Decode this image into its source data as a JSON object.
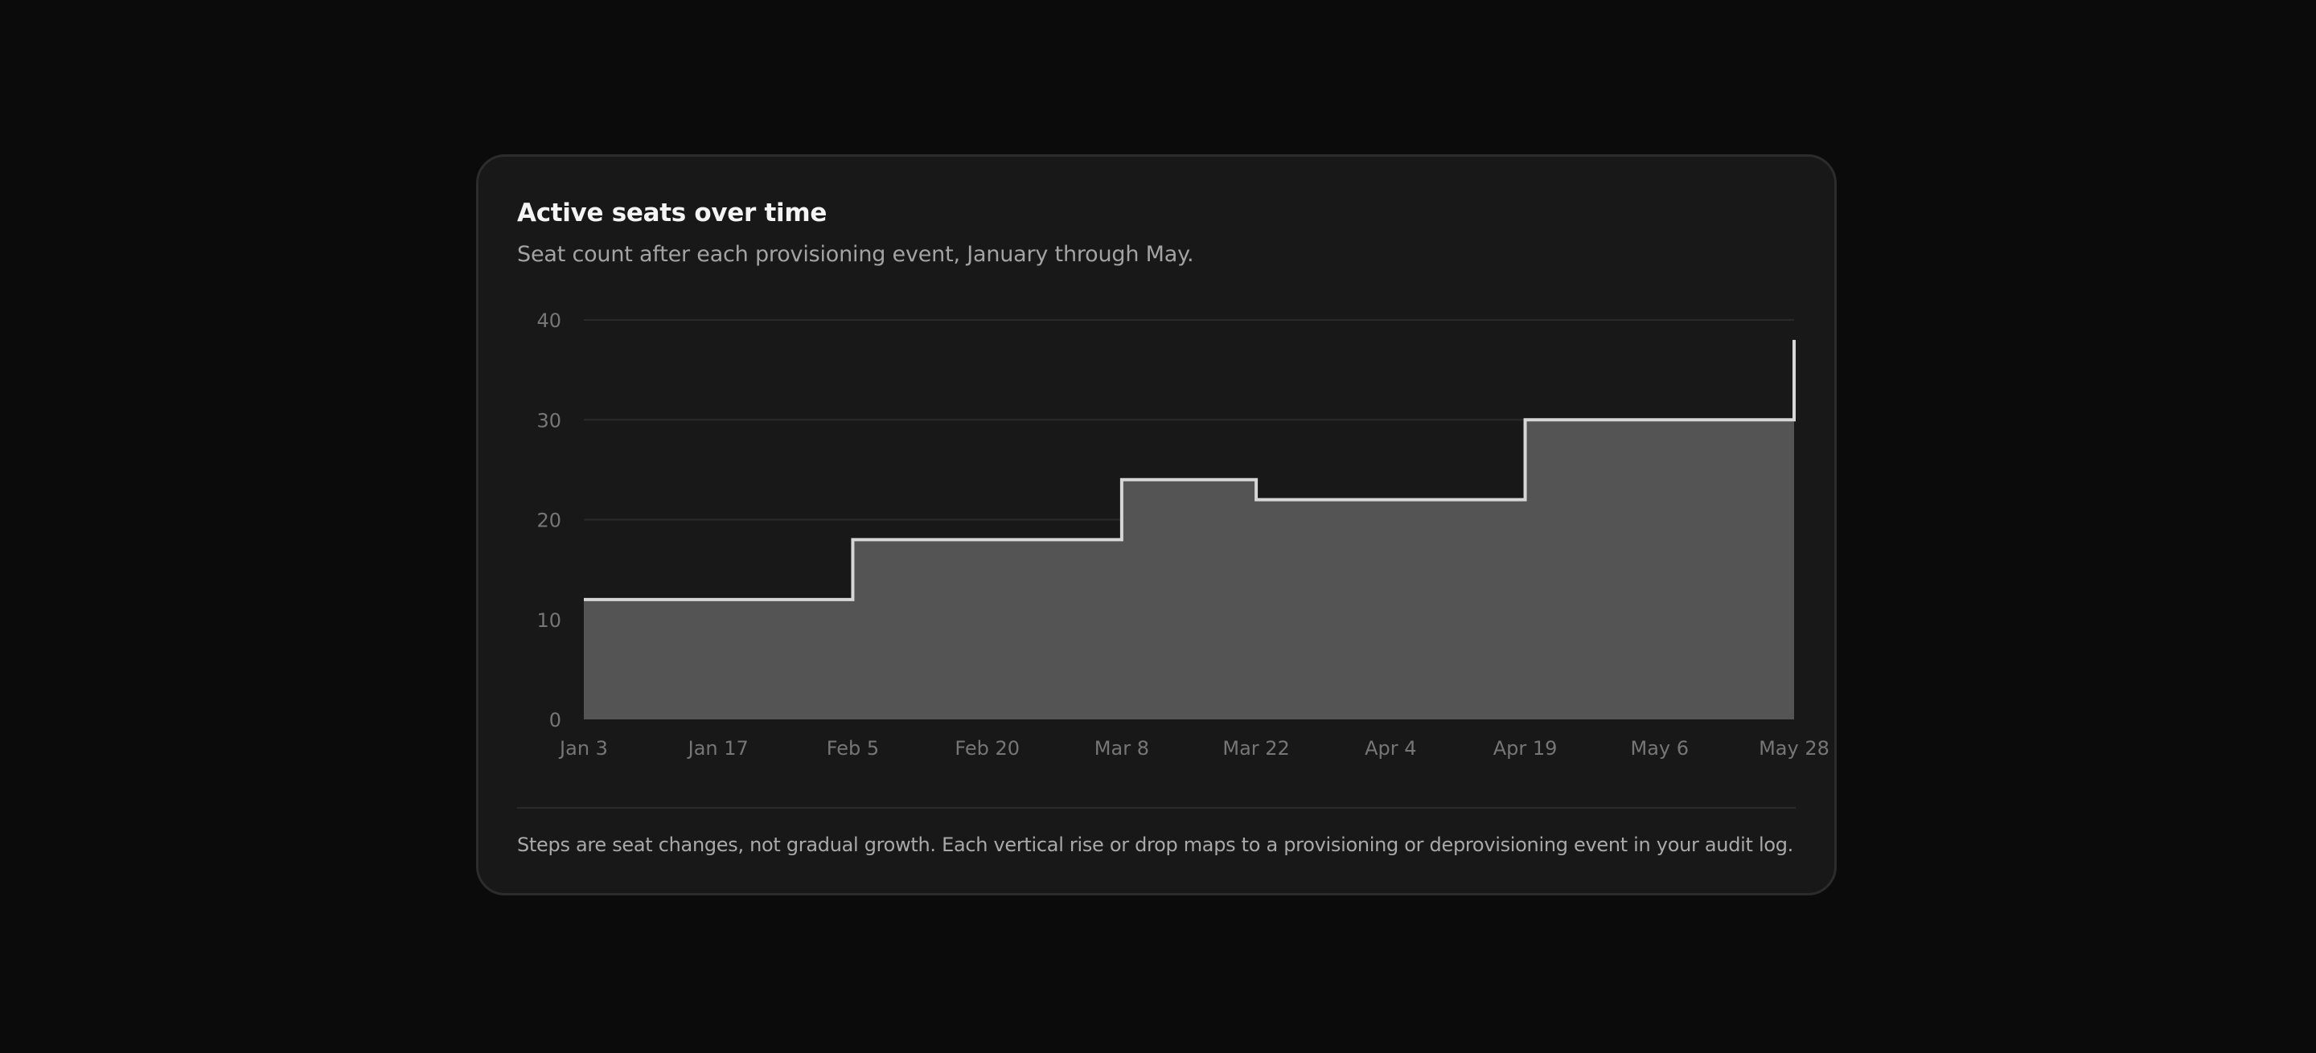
{
  "card": {
    "title": "Active seats over time",
    "subtitle": "Seat count after each provisioning event, January through May.",
    "footnote": "Steps are seat changes, not gradual growth. Each vertical rise or drop maps to a provisioning or deprovisioning event in your audit log."
  },
  "chart_data": {
    "type": "area",
    "step": "after",
    "title": "Active seats over time",
    "subtitle": "Seat count after each provisioning event, January through May.",
    "xlabel": "",
    "ylabel": "",
    "categories": [
      "Jan 3",
      "Jan 17",
      "Feb 5",
      "Feb 20",
      "Mar 8",
      "Mar 22",
      "Apr 4",
      "Apr 19",
      "May 6",
      "May 28"
    ],
    "y_ticks": [
      0,
      10,
      20,
      30,
      40
    ],
    "ylim": [
      0,
      40
    ],
    "grid": true,
    "legend": "none",
    "series": [
      {
        "name": "",
        "values": [
          12,
          12,
          18,
          18,
          24,
          22,
          22,
          30,
          30,
          38
        ]
      }
    ],
    "colors": {
      "line": "#d6d6d6",
      "fill": "#545454",
      "grid": "#2a2a2a"
    }
  }
}
